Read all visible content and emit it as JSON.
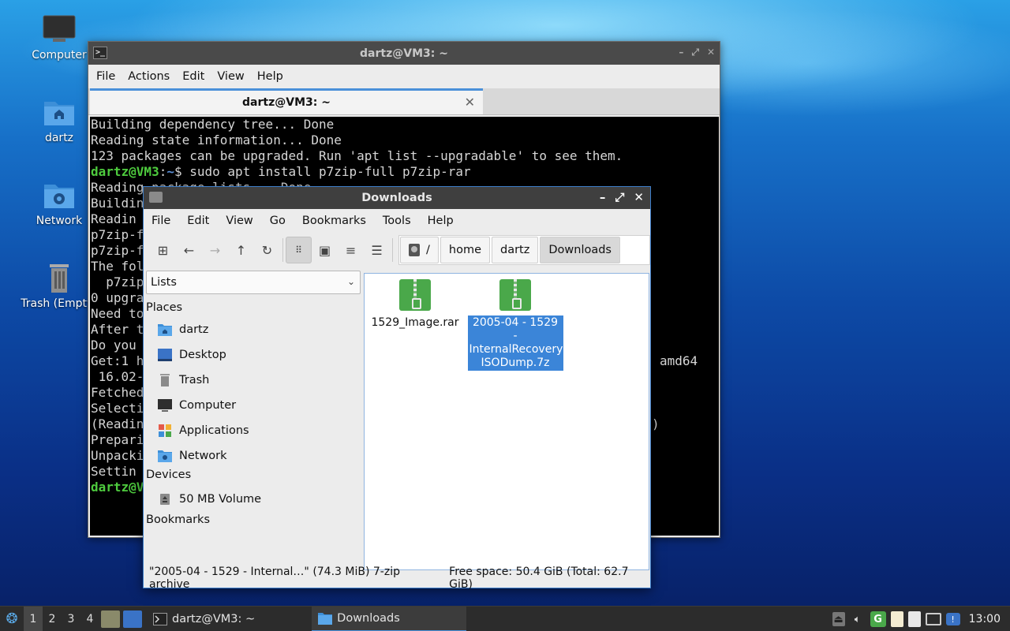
{
  "desktop": {
    "icons": [
      {
        "label": "Computer",
        "icon": "computer-icon"
      },
      {
        "label": "dartz",
        "icon": "home-folder-icon"
      },
      {
        "label": "Network",
        "icon": "network-folder-icon"
      },
      {
        "label": "Trash (Empty)",
        "icon": "trash-icon"
      }
    ]
  },
  "terminal": {
    "window_title": "dartz@VM3: ~",
    "menu": [
      "File",
      "Actions",
      "Edit",
      "View",
      "Help"
    ],
    "tab_label": "dartz@VM3: ~",
    "lines": [
      "Building dependency tree... Done",
      "Reading state information... Done",
      "123 packages can be upgraded. Run 'apt list --upgradable' to see them."
    ],
    "prompt_user": "dartz@VM3",
    "prompt_sep": ":",
    "prompt_path": "~",
    "prompt_sign": "$",
    "command": " sudo apt install p7zip-full p7zip-rar",
    "partial_lines": [
      "Reading package lists... Done",
      "Buildin",
      "Readin",
      "p7zip-f",
      "p7zip-f",
      "The fol",
      "  p7zip",
      "0 upgra",
      "Need to",
      "After t",
      "Do you ",
      "Get:1 h",
      " 16.02-",
      "Fetched",
      "Selecti",
      "(Readin",
      "Prepari",
      "Unpacki",
      "Settin",
      "dartz@V"
    ],
    "right_fragments": {
      "amd64": "amd64",
      "paren": ")"
    }
  },
  "file_manager": {
    "window_title": "Downloads",
    "menu": [
      "File",
      "Edit",
      "View",
      "Go",
      "Bookmarks",
      "Tools",
      "Help"
    ],
    "breadcrumbs": [
      "/",
      "home",
      "dartz",
      "Downloads"
    ],
    "side_select": "Lists",
    "sections": {
      "places": "Places",
      "devices": "Devices",
      "bookmarks": "Bookmarks"
    },
    "places": [
      {
        "label": "dartz",
        "icon": "home-folder-icon"
      },
      {
        "label": "Desktop",
        "icon": "desktop-icon"
      },
      {
        "label": "Trash",
        "icon": "trash-icon"
      },
      {
        "label": "Computer",
        "icon": "computer-icon"
      },
      {
        "label": "Applications",
        "icon": "applications-icon"
      },
      {
        "label": "Network",
        "icon": "network-folder-icon"
      }
    ],
    "devices": [
      {
        "label": "50 MB Volume",
        "icon": "drive-icon"
      }
    ],
    "files": [
      {
        "name": "1529_Image.rar",
        "selected": false
      },
      {
        "name": "2005-04 - 1529 - InternalRecoveryISODump.7z",
        "line1": "2005-04 - 1529 -",
        "line2": "InternalRecovery",
        "line3": "ISODump.7z",
        "selected": true
      }
    ],
    "status_selection": "\"2005-04 - 1529 - Internal…\" (74.3 MiB) 7-zip archive",
    "status_free": "Free space: 50.4 GiB (Total: 62.7 GiB)"
  },
  "taskbar": {
    "workspaces": [
      "1",
      "2",
      "3",
      "4"
    ],
    "tasks": [
      {
        "label": "dartz@VM3: ~",
        "active": false
      },
      {
        "label": "Downloads",
        "active": true
      }
    ],
    "clock": "13:00"
  },
  "colors": {
    "accent": "#4a90d9",
    "selection": "#3b85d8",
    "prompt_green": "#4ecb3e",
    "prompt_blue": "#5b8fd6",
    "archive_green": "#4aa84a"
  }
}
